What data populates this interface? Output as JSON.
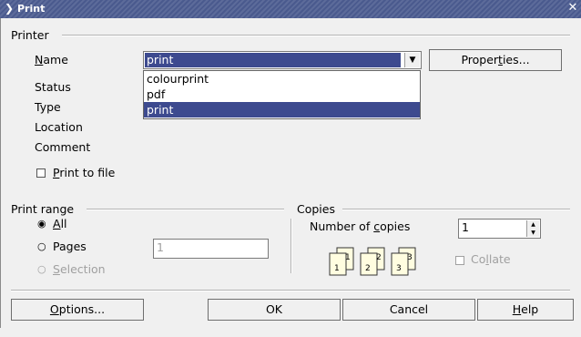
{
  "window": {
    "title": "Print",
    "menu_icon": "menu-chevron-icon",
    "close_icon": "close-icon"
  },
  "printer": {
    "group_label": "Printer",
    "name_label": "Name",
    "name_value": "print",
    "properties_button": "Properties...",
    "status_label": "Status",
    "type_label": "Type",
    "location_label": "Location",
    "comment_label": "Comment",
    "print_to_file_label": "Print to file",
    "print_to_file_checked": false,
    "dropdown_options": [
      "colourprint",
      "pdf",
      "print"
    ],
    "dropdown_selected": "print"
  },
  "print_range": {
    "group_label": "Print range",
    "all_label": "All",
    "pages_label": "Pages",
    "selection_label": "Selection",
    "selected": "All",
    "pages_value": "1"
  },
  "copies": {
    "group_label": "Copies",
    "number_label": "Number of copies",
    "number_value": "1",
    "collate_label": "Collate",
    "collate_checked": false,
    "page_numbers": [
      "1",
      "1",
      "2",
      "2",
      "3",
      "3"
    ]
  },
  "buttons": {
    "options": "Options...",
    "ok": "OK",
    "cancel": "Cancel",
    "help": "Help"
  },
  "colors": {
    "title_bar": "#4a5a8e",
    "selection": "#3d4a8f",
    "background": "#f0f0f0"
  }
}
